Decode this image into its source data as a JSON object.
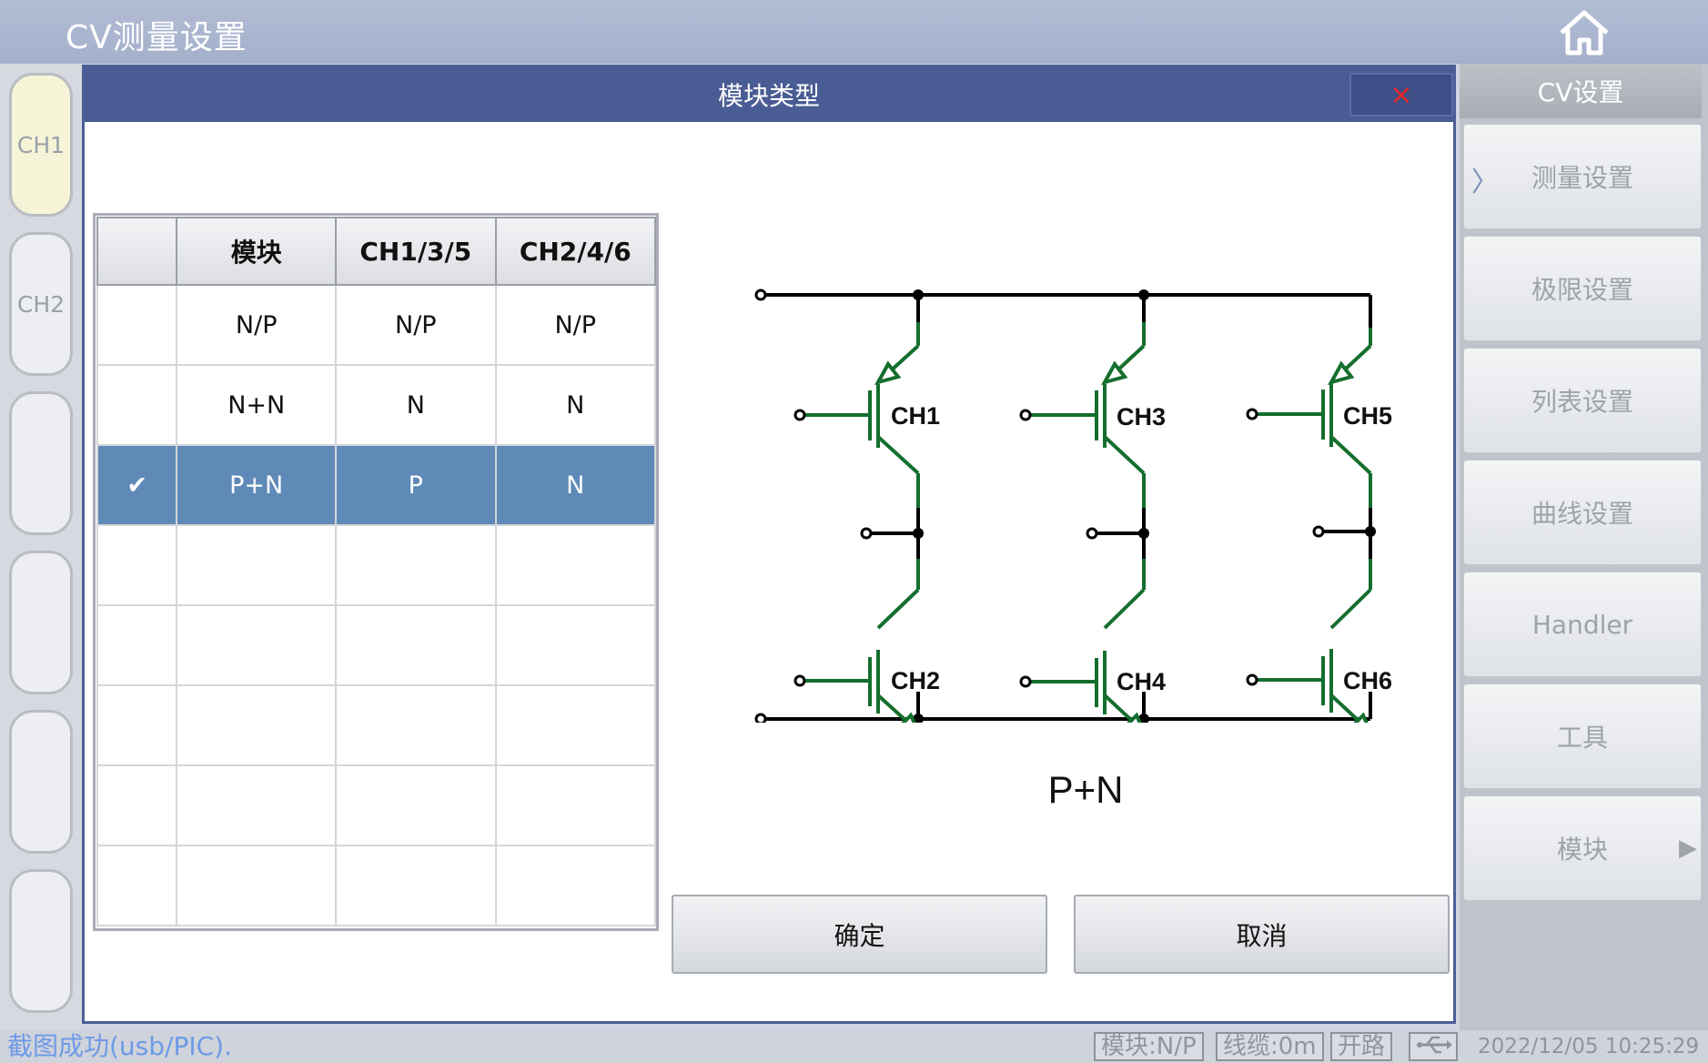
{
  "app": {
    "title": "CV测量设置"
  },
  "channels": [
    "CH1",
    "CH2",
    "",
    "",
    "",
    ""
  ],
  "right_menu": {
    "header": "CV设置",
    "items": [
      "测量设置",
      "极限设置",
      "列表设置",
      "曲线设置",
      "Handler",
      "工具",
      "模块"
    ]
  },
  "dialog": {
    "title": "模块类型",
    "close_symbol": "×",
    "table": {
      "headers": [
        "",
        "模块",
        "CH1/3/5",
        "CH2/4/6"
      ],
      "rows": [
        {
          "check": "",
          "module": "N/P",
          "ch135": "N/P",
          "ch246": "N/P"
        },
        {
          "check": "",
          "module": "N+N",
          "ch135": "N",
          "ch246": "N"
        },
        {
          "check": "✔",
          "module": "P+N",
          "ch135": "P",
          "ch246": "N"
        },
        {
          "check": "",
          "module": "",
          "ch135": "",
          "ch246": ""
        },
        {
          "check": "",
          "module": "",
          "ch135": "",
          "ch246": ""
        },
        {
          "check": "",
          "module": "",
          "ch135": "",
          "ch246": ""
        },
        {
          "check": "",
          "module": "",
          "ch135": "",
          "ch246": ""
        },
        {
          "check": "",
          "module": "",
          "ch135": "",
          "ch246": ""
        }
      ]
    },
    "diagram": {
      "channel_labels": [
        "CH1",
        "CH3",
        "CH5",
        "CH2",
        "CH4",
        "CH6"
      ],
      "caption": "P+N"
    },
    "ok_label": "确定",
    "cancel_label": "取消"
  },
  "status": {
    "message": "截图成功(usb/PIC).",
    "module": "模块:N/P",
    "cable": "线缆:0m",
    "circuit": "开路",
    "datetime": "2022/12/05 10:25:29"
  },
  "colors": {
    "dialog_header": "#4a5c94",
    "selected_row": "#5f8ab8",
    "circuit_green": "#146e2d"
  },
  "icons": {
    "home": "home-icon",
    "close": "close-icon",
    "usb": "usb-icon",
    "submenu": "arrow-right-icon"
  }
}
